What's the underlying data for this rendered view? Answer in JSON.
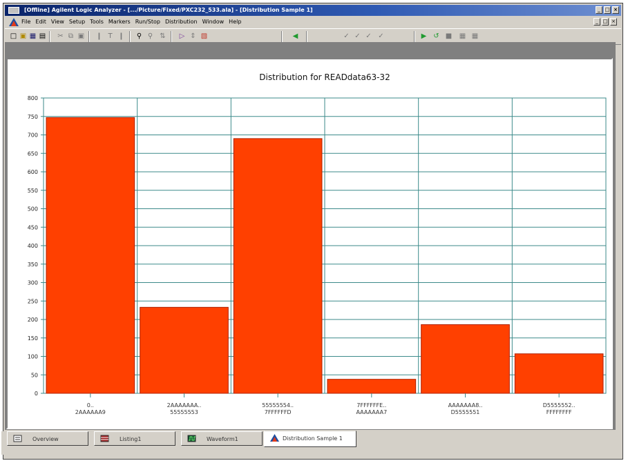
{
  "window": {
    "title": "[Offline] Agilent Logic Analyzer - [.../Picture/Fixed/PXC232_533.ala] - [Distribution Sample 1]",
    "controls": [
      "_",
      "□",
      "×"
    ]
  },
  "menubar": {
    "items": [
      "File",
      "Edit",
      "View",
      "Setup",
      "Tools",
      "Markers",
      "Run/Stop",
      "Distribution",
      "Window",
      "Help"
    ],
    "mdi_controls": [
      "_",
      "□",
      "×"
    ]
  },
  "toolbar": {
    "icons": [
      "new-icon",
      "open-icon",
      "save-icon",
      "print-icon",
      "cut-icon",
      "copy-icon",
      "paste-icon",
      "goto-start-icon",
      "goto-trigger-icon",
      "goto-end-icon",
      "zoom-icon",
      "zoom-out-icon",
      "marker-icon",
      "filter-icon",
      "split-icon",
      "color-icon",
      "green-arrow-icon",
      "check-icon",
      "check-icon",
      "check-icon",
      "check-icon",
      "run-icon",
      "run-repetitive-icon",
      "stop-icon",
      "grid-icon",
      "grid-icon"
    ]
  },
  "tabs": [
    {
      "label": "Overview",
      "icon": "overview-icon",
      "active": false
    },
    {
      "label": "Listing1",
      "icon": "listing-icon",
      "active": false
    },
    {
      "label": "Waveform1",
      "icon": "waveform-icon",
      "active": false
    },
    {
      "label": "Distribution Sample 1",
      "icon": "distribution-icon",
      "active": true
    }
  ],
  "colors": {
    "bar": "#ff4000",
    "grid": "#3b8a8a",
    "accent": "#0a246a"
  },
  "chart_data": {
    "type": "bar",
    "title": "Distribution for READdata63-32",
    "categories": [
      [
        "0..",
        "2AAAAAA9"
      ],
      [
        "2AAAAAAA..",
        "55555553"
      ],
      [
        "55555554..",
        "7FFFFFFD"
      ],
      [
        "7FFFFFFE..",
        "AAAAAAA7"
      ],
      [
        "AAAAAAA8..",
        "D5555551"
      ],
      [
        "D5555552..",
        "FFFFFFFF"
      ]
    ],
    "values": [
      747,
      233,
      690,
      38,
      186,
      107
    ],
    "ylim": [
      0,
      800
    ],
    "yticks": [
      0,
      50,
      100,
      150,
      200,
      250,
      300,
      350,
      400,
      450,
      500,
      550,
      600,
      650,
      700,
      750,
      800
    ],
    "grid": true,
    "legend": "none"
  }
}
